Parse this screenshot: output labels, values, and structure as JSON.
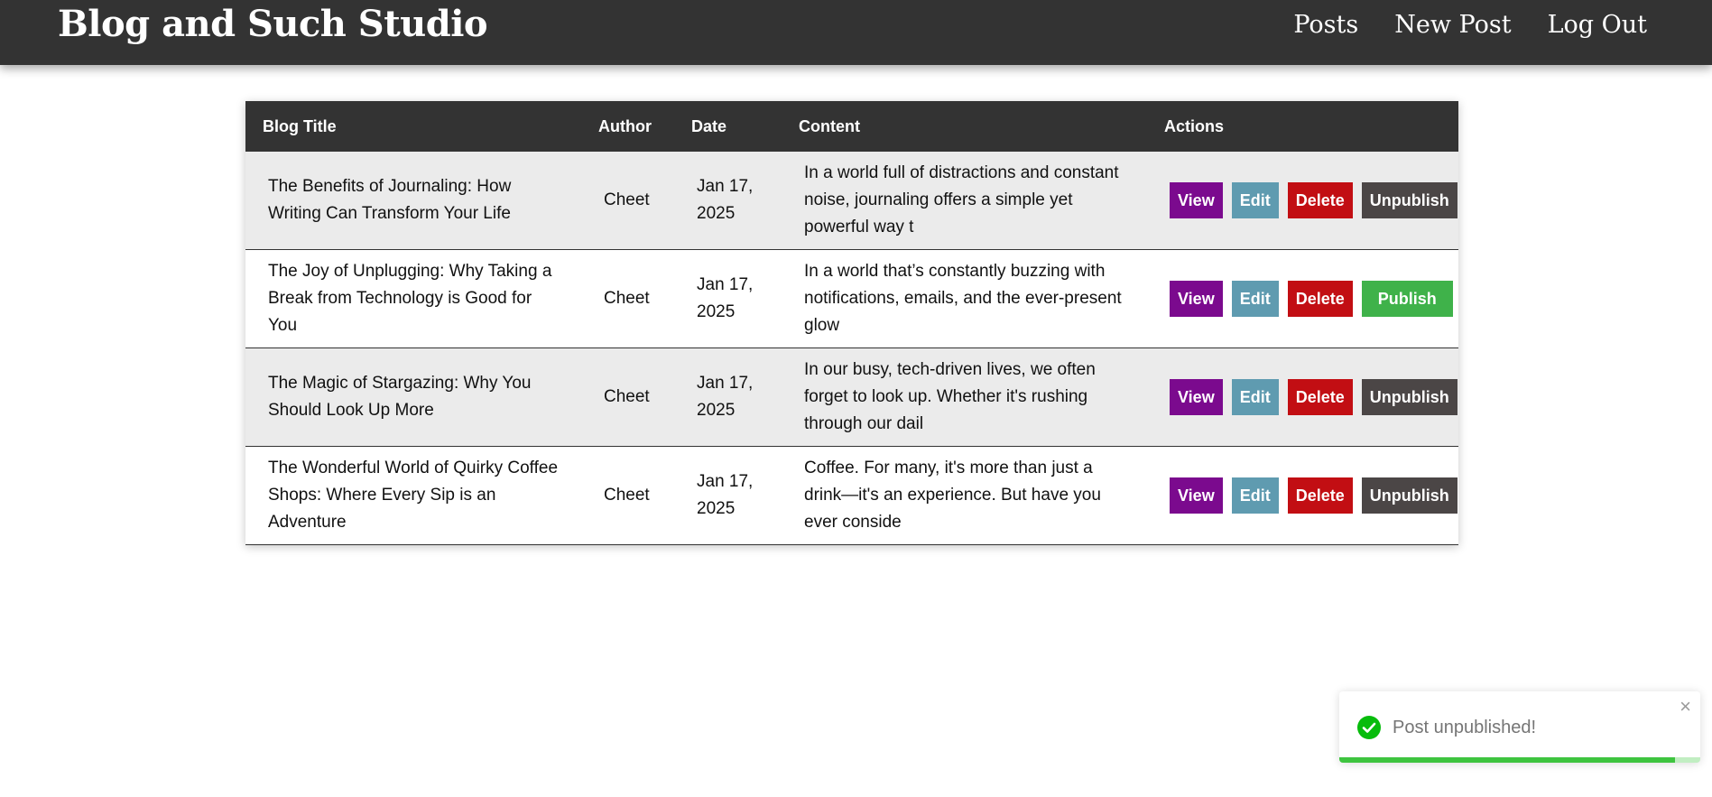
{
  "app": {
    "brand": "Blog and Such Studio"
  },
  "nav": {
    "items": [
      "Posts",
      "New Post",
      "Log Out"
    ]
  },
  "table": {
    "headers": [
      "Blog Title",
      "Author",
      "Date",
      "Content",
      "Actions"
    ],
    "rows": [
      {
        "title": "The Benefits of Journaling: How Writing Can Transform Your Life",
        "author": "Cheet",
        "date": "Jan 17, 2025",
        "content": "In a world full of distractions and constant noise, journaling offers a simple yet powerful way t",
        "publish_label": "Unpublish",
        "published": true
      },
      {
        "title": "The Joy of Unplugging: Why Taking a Break from Technology is Good for You",
        "author": "Cheet",
        "date": "Jan 17, 2025",
        "content": "In a world that’s constantly buzzing with notifications, emails, and the ever-present glow",
        "publish_label": "Publish",
        "published": false
      },
      {
        "title": "The Magic of Stargazing: Why You Should Look Up More",
        "author": "Cheet",
        "date": "Jan 17, 2025",
        "content": "In our busy, tech-driven lives, we often forget to look up. Whether it's rushing through our dail",
        "publish_label": "Unpublish",
        "published": true
      },
      {
        "title": "The Wonderful World of Quirky Coffee Shops: Where Every Sip is an Adventure",
        "author": "Cheet",
        "date": "Jan 17, 2025",
        "content": "Coffee. For many, it's more than just a drink—it's an experience. But have you ever conside",
        "publish_label": "Unpublish",
        "published": true
      }
    ],
    "actions": {
      "view": "View",
      "edit": "Edit",
      "delete": "Delete"
    }
  },
  "toast": {
    "message": "Post unpublished!",
    "close": "×",
    "progress": 0.93,
    "icon": "check-circle-icon"
  },
  "colors": {
    "header_bg": "#333333",
    "view": "#7b0a8e",
    "edit": "#5f9bb0",
    "delete": "#c20e13",
    "unpublish": "#4b4646",
    "publish": "#3fb24a",
    "success": "#07bc0c"
  }
}
